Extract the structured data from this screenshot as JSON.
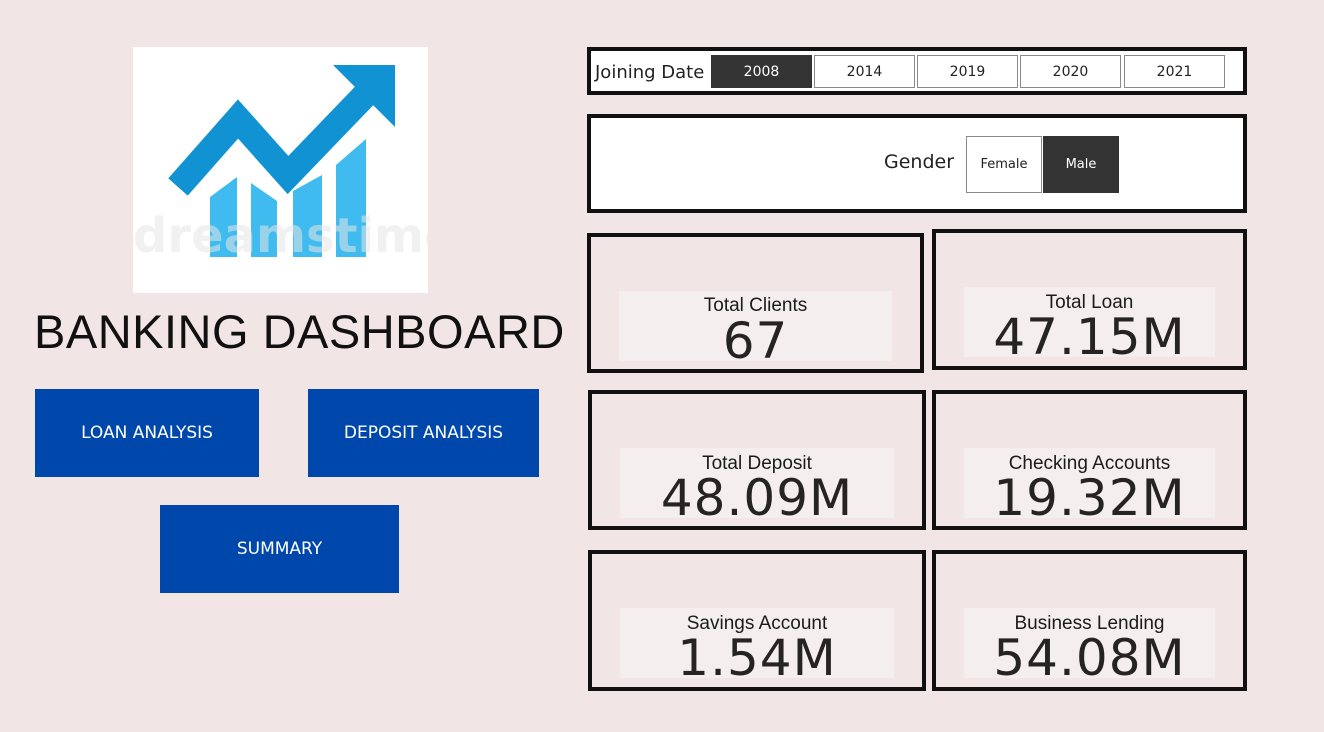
{
  "dashboard": {
    "title": "BANKING DASHBOARD",
    "logo_watermark": "dreamstime"
  },
  "nav": {
    "loan_analysis": "LOAN ANALYSIS",
    "deposit_analysis": "DEPOSIT ANALYSIS",
    "summary": "SUMMARY"
  },
  "filters": {
    "joining_date": {
      "label": "Joining Date",
      "options": [
        "2008",
        "2014",
        "2019",
        "2020",
        "2021"
      ],
      "selected": "2008"
    },
    "gender": {
      "label": "Gender",
      "options": [
        "Female",
        "Male"
      ],
      "selected": "Male"
    }
  },
  "kpis": {
    "total_clients": {
      "label": "Total Clients",
      "value": "67"
    },
    "total_loan": {
      "label": "Total Loan",
      "value": "47.15M"
    },
    "total_deposit": {
      "label": "Total Deposit",
      "value": "48.09M"
    },
    "checking_accounts": {
      "label": "Checking Accounts",
      "value": "19.32M"
    },
    "savings_account": {
      "label": "Savings Account",
      "value": "1.54M"
    },
    "business_lending": {
      "label": "Business Lending",
      "value": "54.08M"
    }
  },
  "colors": {
    "background": "#f1e5e6",
    "button": "#0047ab",
    "slicer_selected": "#333333",
    "logo_arrow": "#1193d3",
    "logo_bars": "#3fbbf0"
  },
  "icons": {
    "logo": "growth-chart-arrow-icon"
  }
}
